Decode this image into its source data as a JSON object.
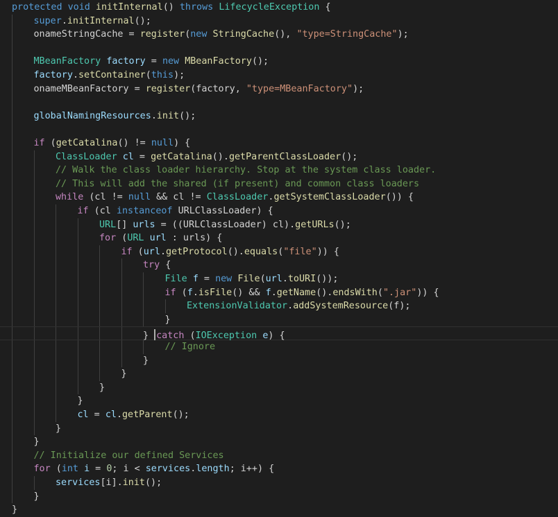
{
  "editor": {
    "theme_colors": {
      "background": "#1e1e1e",
      "keyword": "#569cd6",
      "control": "#c586c0",
      "type": "#4ec9b0",
      "function": "#dcdcaa",
      "variable": "#9cdcfe",
      "string": "#ce9178",
      "comment": "#6a9955",
      "number": "#b5cea8",
      "text": "#d4d4d4"
    },
    "lines": [
      {
        "indent": 0,
        "tokens": [
          [
            "protected",
            "kw"
          ],
          [
            " ",
            "txt"
          ],
          [
            "void",
            "kw"
          ],
          [
            " ",
            "txt"
          ],
          [
            "initInternal",
            "fn"
          ],
          [
            "() ",
            "txt"
          ],
          [
            "throws",
            "kw"
          ],
          [
            " ",
            "txt"
          ],
          [
            "LifecycleException",
            "type"
          ],
          [
            " {",
            "txt"
          ]
        ]
      },
      {
        "indent": 1,
        "tokens": [
          [
            "super",
            "kw"
          ],
          [
            ".",
            "txt"
          ],
          [
            "initInternal",
            "fn"
          ],
          [
            "();",
            "txt"
          ]
        ]
      },
      {
        "indent": 1,
        "tokens": [
          [
            "onameStringCache",
            "txt"
          ],
          [
            " = ",
            "txt"
          ],
          [
            "register",
            "fn"
          ],
          [
            "(",
            "txt"
          ],
          [
            "new",
            "kw"
          ],
          [
            " ",
            "txt"
          ],
          [
            "StringCache",
            "fn"
          ],
          [
            "(), ",
            "txt"
          ],
          [
            "\"type=StringCache\"",
            "str"
          ],
          [
            ");",
            "txt"
          ]
        ]
      },
      {
        "indent": 1,
        "tokens": []
      },
      {
        "indent": 1,
        "tokens": [
          [
            "MBeanFactory",
            "type"
          ],
          [
            " ",
            "txt"
          ],
          [
            "factory",
            "var"
          ],
          [
            " = ",
            "txt"
          ],
          [
            "new",
            "kw"
          ],
          [
            " ",
            "txt"
          ],
          [
            "MBeanFactory",
            "fn"
          ],
          [
            "();",
            "txt"
          ]
        ]
      },
      {
        "indent": 1,
        "tokens": [
          [
            "factory",
            "var"
          ],
          [
            ".",
            "txt"
          ],
          [
            "setContainer",
            "fn"
          ],
          [
            "(",
            "txt"
          ],
          [
            "this",
            "kw"
          ],
          [
            ");",
            "txt"
          ]
        ]
      },
      {
        "indent": 1,
        "tokens": [
          [
            "onameMBeanFactory",
            "txt"
          ],
          [
            " = ",
            "txt"
          ],
          [
            "register",
            "fn"
          ],
          [
            "(factory, ",
            "txt"
          ],
          [
            "\"type=MBeanFactory\"",
            "str"
          ],
          [
            ");",
            "txt"
          ]
        ]
      },
      {
        "indent": 1,
        "tokens": []
      },
      {
        "indent": 1,
        "tokens": [
          [
            "globalNamingResources",
            "var"
          ],
          [
            ".",
            "txt"
          ],
          [
            "init",
            "fn"
          ],
          [
            "();",
            "txt"
          ]
        ]
      },
      {
        "indent": 1,
        "tokens": []
      },
      {
        "indent": 1,
        "tokens": [
          [
            "if",
            "ctrl"
          ],
          [
            " (",
            "txt"
          ],
          [
            "getCatalina",
            "fn"
          ],
          [
            "() != ",
            "txt"
          ],
          [
            "null",
            "kw"
          ],
          [
            ") {",
            "txt"
          ]
        ]
      },
      {
        "indent": 2,
        "tokens": [
          [
            "ClassLoader",
            "type"
          ],
          [
            " ",
            "txt"
          ],
          [
            "cl",
            "var"
          ],
          [
            " = ",
            "txt"
          ],
          [
            "getCatalina",
            "fn"
          ],
          [
            "().",
            "txt"
          ],
          [
            "getParentClassLoader",
            "fn"
          ],
          [
            "();",
            "txt"
          ]
        ]
      },
      {
        "indent": 2,
        "tokens": [
          [
            "// Walk the class loader hierarchy. Stop at the system class loader.",
            "com"
          ]
        ]
      },
      {
        "indent": 2,
        "tokens": [
          [
            "// This will add the shared (if present) and common class loaders",
            "com"
          ]
        ]
      },
      {
        "indent": 2,
        "tokens": [
          [
            "while",
            "ctrl"
          ],
          [
            " (cl != ",
            "txt"
          ],
          [
            "null",
            "kw"
          ],
          [
            " && cl != ",
            "txt"
          ],
          [
            "ClassLoader",
            "type"
          ],
          [
            ".",
            "txt"
          ],
          [
            "getSystemClassLoader",
            "fn"
          ],
          [
            "()) {",
            "txt"
          ]
        ]
      },
      {
        "indent": 3,
        "tokens": [
          [
            "if",
            "ctrl"
          ],
          [
            " (cl ",
            "txt"
          ],
          [
            "instanceof",
            "kw"
          ],
          [
            " URLClassLoader) {",
            "txt"
          ]
        ]
      },
      {
        "indent": 4,
        "tokens": [
          [
            "URL",
            "type"
          ],
          [
            "[] ",
            "txt"
          ],
          [
            "urls",
            "var"
          ],
          [
            " = ((URLClassLoader) cl).",
            "txt"
          ],
          [
            "getURLs",
            "fn"
          ],
          [
            "();",
            "txt"
          ]
        ]
      },
      {
        "indent": 4,
        "tokens": [
          [
            "for",
            "ctrl"
          ],
          [
            " (",
            "txt"
          ],
          [
            "URL",
            "type"
          ],
          [
            " ",
            "txt"
          ],
          [
            "url",
            "var"
          ],
          [
            " : urls) {",
            "txt"
          ]
        ]
      },
      {
        "indent": 5,
        "tokens": [
          [
            "if",
            "ctrl"
          ],
          [
            " (",
            "txt"
          ],
          [
            "url",
            "var"
          ],
          [
            ".",
            "txt"
          ],
          [
            "getProtocol",
            "fn"
          ],
          [
            "().",
            "txt"
          ],
          [
            "equals",
            "fn"
          ],
          [
            "(",
            "txt"
          ],
          [
            "\"file\"",
            "str"
          ],
          [
            ")) {",
            "txt"
          ]
        ]
      },
      {
        "indent": 6,
        "tokens": [
          [
            "try",
            "ctrl"
          ],
          [
            " {",
            "txt"
          ]
        ]
      },
      {
        "indent": 7,
        "tokens": [
          [
            "File",
            "type"
          ],
          [
            " ",
            "txt"
          ],
          [
            "f",
            "var"
          ],
          [
            " = ",
            "txt"
          ],
          [
            "new",
            "kw"
          ],
          [
            " ",
            "txt"
          ],
          [
            "File",
            "fn"
          ],
          [
            "(",
            "txt"
          ],
          [
            "url",
            "var"
          ],
          [
            ".",
            "txt"
          ],
          [
            "toURI",
            "fn"
          ],
          [
            "());",
            "txt"
          ]
        ]
      },
      {
        "indent": 7,
        "tokens": [
          [
            "if",
            "ctrl"
          ],
          [
            " (",
            "txt"
          ],
          [
            "f",
            "var"
          ],
          [
            ".",
            "txt"
          ],
          [
            "isFile",
            "fn"
          ],
          [
            "() && ",
            "txt"
          ],
          [
            "f",
            "var"
          ],
          [
            ".",
            "txt"
          ],
          [
            "getName",
            "fn"
          ],
          [
            "().",
            "txt"
          ],
          [
            "endsWith",
            "fn"
          ],
          [
            "(",
            "txt"
          ],
          [
            "\".jar\"",
            "str"
          ],
          [
            ")) {",
            "txt"
          ]
        ]
      },
      {
        "indent": 8,
        "tokens": [
          [
            "ExtensionValidator",
            "type"
          ],
          [
            ".",
            "txt"
          ],
          [
            "addSystemResource",
            "fn"
          ],
          [
            "(f);",
            "txt"
          ]
        ]
      },
      {
        "indent": 7,
        "tokens": [
          [
            "}",
            "txt"
          ]
        ]
      },
      {
        "indent": 6,
        "tokens": [
          [
            "} ",
            "txt"
          ],
          [
            "catch",
            "ctrl"
          ],
          [
            " (",
            "txt"
          ],
          [
            "IOException",
            "type"
          ],
          [
            " ",
            "txt"
          ],
          [
            "e",
            "var"
          ],
          [
            ") {",
            "txt"
          ]
        ],
        "current": true
      },
      {
        "indent": 7,
        "tokens": [
          [
            "// Ignore",
            "com"
          ]
        ]
      },
      {
        "indent": 6,
        "tokens": [
          [
            "}",
            "txt"
          ]
        ]
      },
      {
        "indent": 5,
        "tokens": [
          [
            "}",
            "txt"
          ]
        ]
      },
      {
        "indent": 4,
        "tokens": [
          [
            "}",
            "txt"
          ]
        ]
      },
      {
        "indent": 3,
        "tokens": [
          [
            "}",
            "txt"
          ]
        ]
      },
      {
        "indent": 3,
        "tokens": [
          [
            "cl",
            "var"
          ],
          [
            " = ",
            "txt"
          ],
          [
            "cl",
            "var"
          ],
          [
            ".",
            "txt"
          ],
          [
            "getParent",
            "fn"
          ],
          [
            "();",
            "txt"
          ]
        ]
      },
      {
        "indent": 2,
        "tokens": [
          [
            "}",
            "txt"
          ]
        ]
      },
      {
        "indent": 1,
        "tokens": [
          [
            "}",
            "txt"
          ]
        ]
      },
      {
        "indent": 1,
        "tokens": [
          [
            "// Initialize our defined Services",
            "com"
          ]
        ]
      },
      {
        "indent": 1,
        "tokens": [
          [
            "for",
            "ctrl"
          ],
          [
            " (",
            "txt"
          ],
          [
            "int",
            "kw"
          ],
          [
            " ",
            "txt"
          ],
          [
            "i",
            "var"
          ],
          [
            " = ",
            "txt"
          ],
          [
            "0",
            "num"
          ],
          [
            "; i < ",
            "txt"
          ],
          [
            "services",
            "var"
          ],
          [
            ".",
            "txt"
          ],
          [
            "length",
            "var"
          ],
          [
            "; i++) {",
            "txt"
          ]
        ]
      },
      {
        "indent": 2,
        "tokens": [
          [
            "services",
            "var"
          ],
          [
            "[i].",
            "txt"
          ],
          [
            "init",
            "fn"
          ],
          [
            "();",
            "txt"
          ]
        ]
      },
      {
        "indent": 1,
        "tokens": [
          [
            "}",
            "txt"
          ]
        ]
      },
      {
        "indent": 0,
        "tokens": [
          [
            "}",
            "txt"
          ]
        ]
      }
    ]
  }
}
